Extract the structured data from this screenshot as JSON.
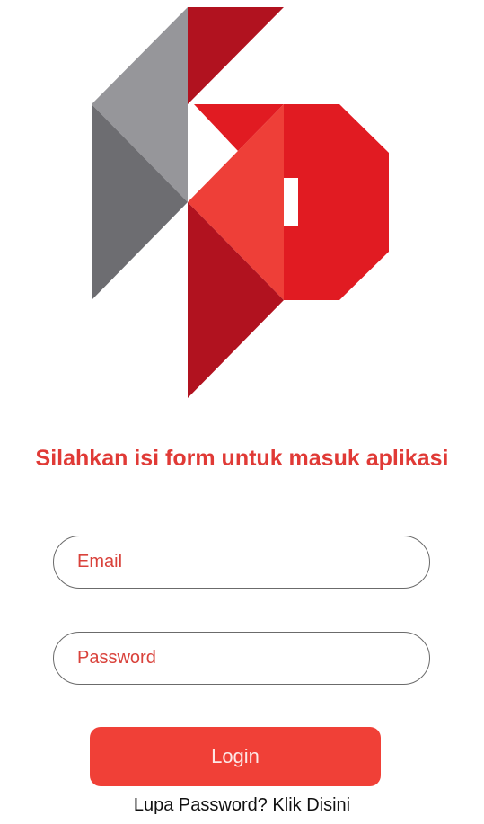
{
  "logo": {
    "icon": "kp-logo",
    "colors": {
      "red_dark": "#b1121f",
      "red": "#e11b22",
      "red_light": "#ee3f38",
      "gray_light": "#96969a",
      "gray_dark": "#6d6d71"
    }
  },
  "heading": {
    "text": "Silahkan isi form untuk masuk aplikasi",
    "color": "#e03a36"
  },
  "form": {
    "email": {
      "placeholder": "Email",
      "value": ""
    },
    "password": {
      "placeholder": "Password",
      "value": ""
    },
    "login_label": "Login",
    "login_color": "#f04037"
  },
  "forgot": {
    "prefix": "Lupa Password?",
    "link": "Klik Disini"
  }
}
